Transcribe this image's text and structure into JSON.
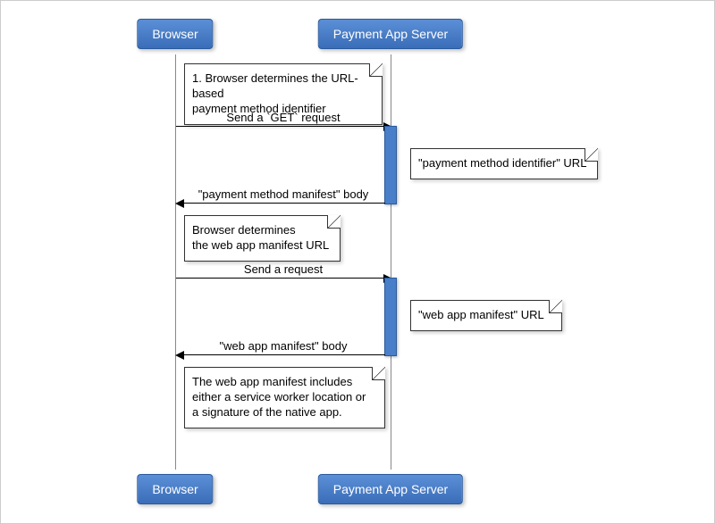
{
  "participants": {
    "browser": "Browser",
    "server": "Payment App Server"
  },
  "notes": {
    "n1": "1. Browser determines the URL-based\npayment method identifier",
    "n2": "\"payment method identifier\" URL",
    "n3": "Browser determines\nthe web app manifest URL",
    "n4": "\"web app manifest\" URL",
    "n5": "The web app manifest includes\neither a service worker location or\na signature of the native app."
  },
  "messages": {
    "m1": "Send a `GET` request",
    "m2": "\"payment method manifest\" body",
    "m3": "Send a request",
    "m4": "\"web app manifest\" body"
  },
  "chart_data": {
    "type": "sequence-diagram",
    "participants": [
      "Browser",
      "Payment App Server"
    ],
    "events": [
      {
        "kind": "note",
        "attached_to": "Browser",
        "text": "1. Browser determines the URL-based payment method identifier"
      },
      {
        "kind": "message",
        "from": "Browser",
        "to": "Payment App Server",
        "text": "Send a `GET` request"
      },
      {
        "kind": "note",
        "attached_to": "Payment App Server",
        "side": "right",
        "text": "\"payment method identifier\" URL"
      },
      {
        "kind": "message",
        "from": "Payment App Server",
        "to": "Browser",
        "text": "\"payment method manifest\" body"
      },
      {
        "kind": "note",
        "attached_to": "Browser",
        "text": "Browser determines the web app manifest URL"
      },
      {
        "kind": "message",
        "from": "Browser",
        "to": "Payment App Server",
        "text": "Send a request"
      },
      {
        "kind": "note",
        "attached_to": "Payment App Server",
        "side": "right",
        "text": "\"web app manifest\" URL"
      },
      {
        "kind": "message",
        "from": "Payment App Server",
        "to": "Browser",
        "text": "\"web app manifest\" body"
      },
      {
        "kind": "note",
        "attached_to": "Browser",
        "text": "The web app manifest includes either a service worker location or a signature of the native app."
      }
    ]
  }
}
